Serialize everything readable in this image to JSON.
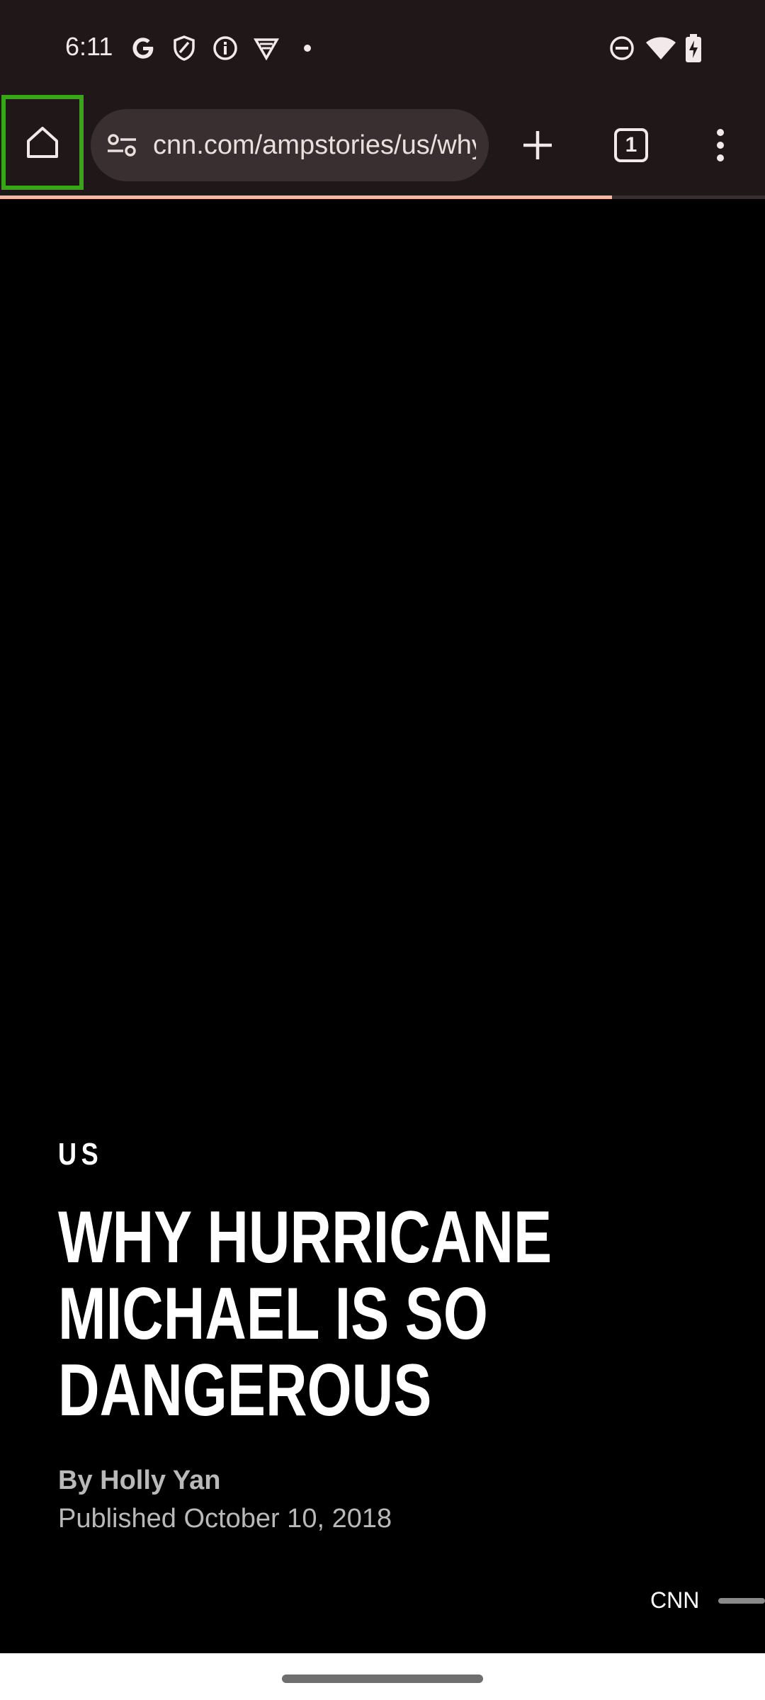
{
  "status_bar": {
    "time": "6:11",
    "left_icons": [
      "google-icon",
      "shield-icon",
      "info-icon",
      "vpn-icon",
      "notification-dot-icon"
    ],
    "right_icons": [
      "do-not-disturb-icon",
      "wifi-icon",
      "battery-charging-icon"
    ]
  },
  "toolbar": {
    "url": "cnn.com/ampstories/us/why-hurricane-michael-is-so-dangerous",
    "tab_count": "1",
    "load_progress": 0.8
  },
  "story": {
    "section": "US",
    "headline": "WHY HURRICANE MICHAEL IS SO DANGEROUS",
    "byline": "By Holly Yan",
    "published": "Published October 10, 2018",
    "brand": "CNN"
  },
  "colors": {
    "chrome_bg": "#1f1718",
    "url_bar_bg": "#3a2f30",
    "highlight": "#3aa51a",
    "progress": "#f4b8a3"
  }
}
